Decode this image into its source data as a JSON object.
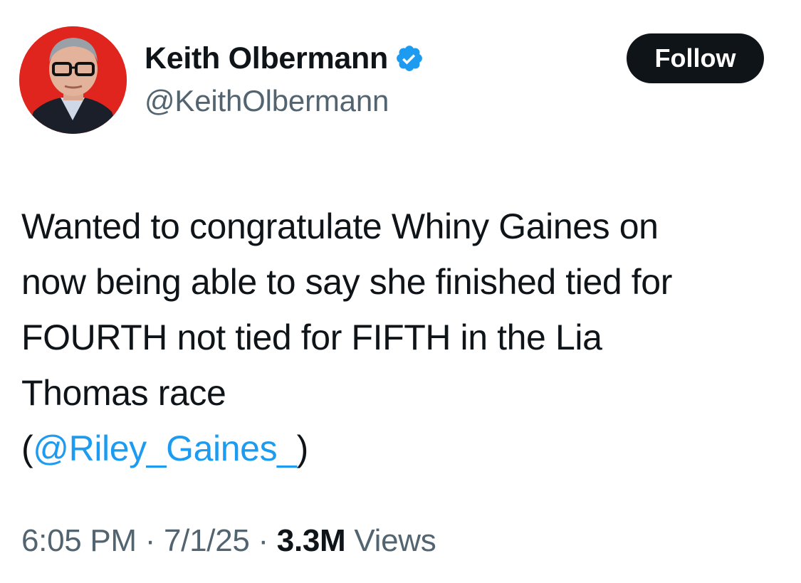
{
  "author": {
    "display_name": "Keith Olbermann",
    "handle": "@KeithOlbermann",
    "verified_icon": "verified-badge-icon",
    "avatar_background": "#e0251f"
  },
  "follow_button": {
    "label": "Follow"
  },
  "tweet": {
    "lines": [
      "Wanted to congratulate Whiny Gaines on",
      "now being able to say she finished tied for",
      "FOURTH not tied for FIFTH in the Lia",
      "Thomas race"
    ],
    "mention_open": "(",
    "mention": "@Riley_Gaines_",
    "mention_close": ")"
  },
  "meta": {
    "time": "6:05 PM",
    "separator": "·",
    "date": "7/1/25",
    "views_count": "3.3M",
    "views_label": "Views"
  },
  "colors": {
    "text": "#0f1419",
    "secondary": "#536471",
    "link": "#1d9bf0",
    "verified": "#1d9bf0"
  }
}
